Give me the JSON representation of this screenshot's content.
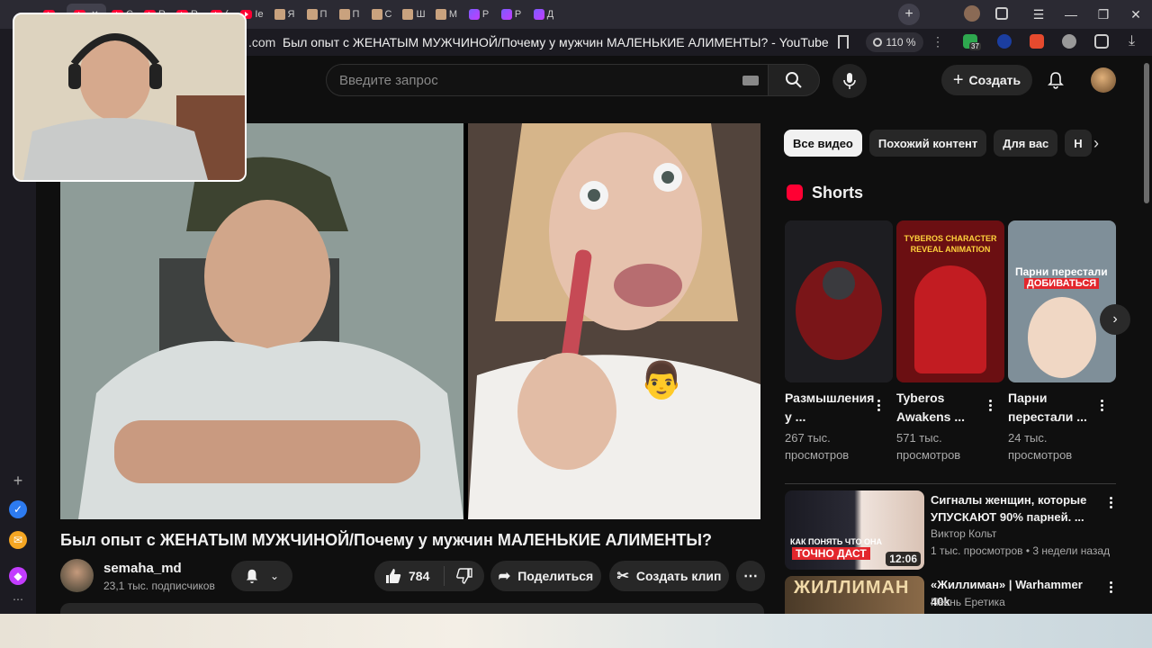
{
  "browser": {
    "tabs": [
      {
        "icon": "yt",
        "label": ""
      },
      {
        "icon": "yt",
        "label": "",
        "active": true
      },
      {
        "icon": "yt",
        "label": "C"
      },
      {
        "icon": "yt",
        "label": "R"
      },
      {
        "icon": "yt",
        "label": "R"
      },
      {
        "icon": "yt",
        "label": "("
      },
      {
        "icon": "yt",
        "label": "Iе"
      },
      {
        "icon": "pic",
        "label": "Я"
      },
      {
        "icon": "pic",
        "label": "П"
      },
      {
        "icon": "pic",
        "label": "П"
      },
      {
        "icon": "pic",
        "label": "C"
      },
      {
        "icon": "pic",
        "label": "Ш"
      },
      {
        "icon": "pic",
        "label": "M"
      },
      {
        "icon": "ai",
        "label": "P"
      },
      {
        "icon": "ai",
        "label": "P"
      },
      {
        "icon": "ai",
        "label": "Д"
      }
    ],
    "close_glyph": "✕",
    "new_tab_glyph": "+",
    "url_fragment": ".com",
    "page_title": "Был опыт с ЖЕНАТЫМ МУЖЧИНОЙ/Почему у мужчин МАЛЕНЬКИЕ АЛИМЕНТЫ? - YouTube",
    "zoom": "110 %",
    "ext_badge": "37"
  },
  "header": {
    "search_placeholder": "Введите запрос",
    "create_label": "Создать"
  },
  "video": {
    "title": "Был опыт с ЖЕНАТЫМ МУЖЧИНОЙ/Почему у мужчин МАЛЕНЬКИЕ АЛИМЕНТЫ?",
    "channel": "semaha_md",
    "subscribers": "23,1 тыс. подписчиков",
    "likes": "784",
    "share_label": "Поделиться",
    "clip_label": "Создать клип",
    "emoji": "👨"
  },
  "chips": [
    "Все видео",
    "Похожий контент",
    "Для вас",
    "Н"
  ],
  "shorts": {
    "section_title": "Shorts",
    "items": [
      {
        "title": "Размышления у ...",
        "views": "267 тыс. просмотров",
        "color": "#2a2a2e"
      },
      {
        "title": "Tyberos Awakens ...",
        "views": "571 тыс. просмотров",
        "color": "#6b0f12",
        "overlay": "TYBEROS CHARACTER REVEAL ANIMATION"
      },
      {
        "title": "Парни перестали ...",
        "views": "24 тыс. просмотров",
        "color": "#7f8f99",
        "overlay_a": "Парни перестали",
        "overlay_b": "ДОБИВАТЬСЯ"
      }
    ]
  },
  "recommendations": [
    {
      "title": "Сигналы женщин, которые УПУСКАЮТ 90% парней. ...",
      "channel": "Виктор Кольт",
      "meta": "1 тыс. просмотров • 3 недели назад",
      "duration": "12:06",
      "thumb_a": "КАК ПОНЯТЬ ЧТО ОНА",
      "thumb_b": "ТОЧНО ДАСТ"
    },
    {
      "title": "«Жиллиман» | Warhammer 40k",
      "channel": "Песнь Еретика",
      "thumb_a": "ЖИЛЛИМАН"
    }
  ],
  "colors": {
    "accent": "#ff0033",
    "background": "#0f0f0f",
    "surface": "#272727"
  }
}
